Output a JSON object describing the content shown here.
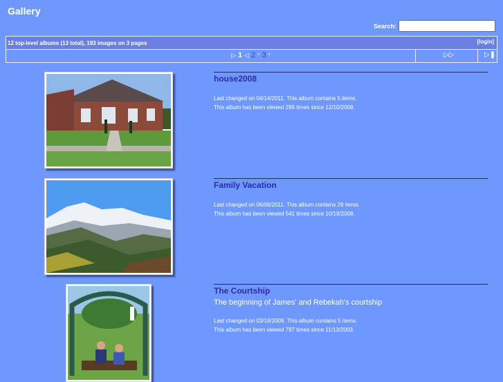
{
  "header": {
    "title": "Gallery"
  },
  "search": {
    "label": "Search:",
    "value": "",
    "placeholder": ""
  },
  "info": {
    "summary": "12 top-level albums (13 total), 193 images on 3 pages",
    "login": "[login]"
  },
  "pager": {
    "current": "1",
    "pages": [
      "2",
      "3"
    ],
    "next_icon": "next-page-icon",
    "last_icon": "last-page-icon"
  },
  "albums": [
    {
      "title": "house2008",
      "description": "",
      "changed": "Last changed on 04/14/2011.  This album contains 5 items.",
      "viewed": "This album has been viewed 299 times since 12/10/2008."
    },
    {
      "title": "Family Vacation",
      "description": "",
      "changed": "Last changed on 06/06/2011.  This album contains 29 items.",
      "viewed": "This album has been viewed 541 times since 10/19/2008."
    },
    {
      "title": "The Courtship",
      "description": "The beginning of James' and Rebekah's courtship",
      "changed": "Last changed on 03/18/2009.  This album contains 5 items.",
      "viewed": "This album has been viewed 797 times since 11/13/2003."
    }
  ]
}
